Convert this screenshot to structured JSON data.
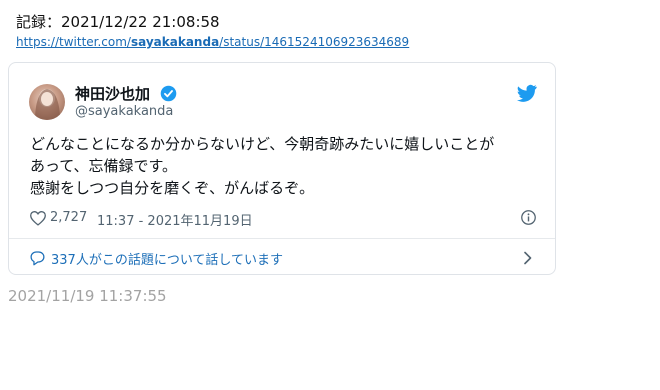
{
  "record": {
    "label": "記録：2021/12/22 21:08:58"
  },
  "source_link": {
    "prefix": "https://twitter.com/",
    "user": "sayakakanda",
    "suffix": "/status/1461524106923634689"
  },
  "tweet": {
    "author_name": "神田沙也加",
    "author_handle": "@sayakakanda",
    "text_lines": [
      "どんなことになるか分からないけど、今朝奇跡みたいに嬉しいことが",
      "あって、忘備録です。",
      "感謝をしつつ自分を磨くぞ、がんばるぞ。"
    ],
    "like_count": "2,727",
    "timestamp": "11:37 - 2021年11月19日",
    "reply_prompt": "337人がこの話題について話しています"
  },
  "post_date": "2021/11/19 11:37:55",
  "icons": {
    "verified": "verified-badge-icon",
    "bird": "twitter-bird-icon",
    "heart": "heart-icon",
    "info": "info-icon",
    "reply": "speech-bubble-icon",
    "chevron": "chevron-right-icon"
  },
  "colors": {
    "accent": "#1d9bf0",
    "link": "#1a6bb5",
    "muted": "#536471",
    "post_date": "#a3a3a3"
  }
}
